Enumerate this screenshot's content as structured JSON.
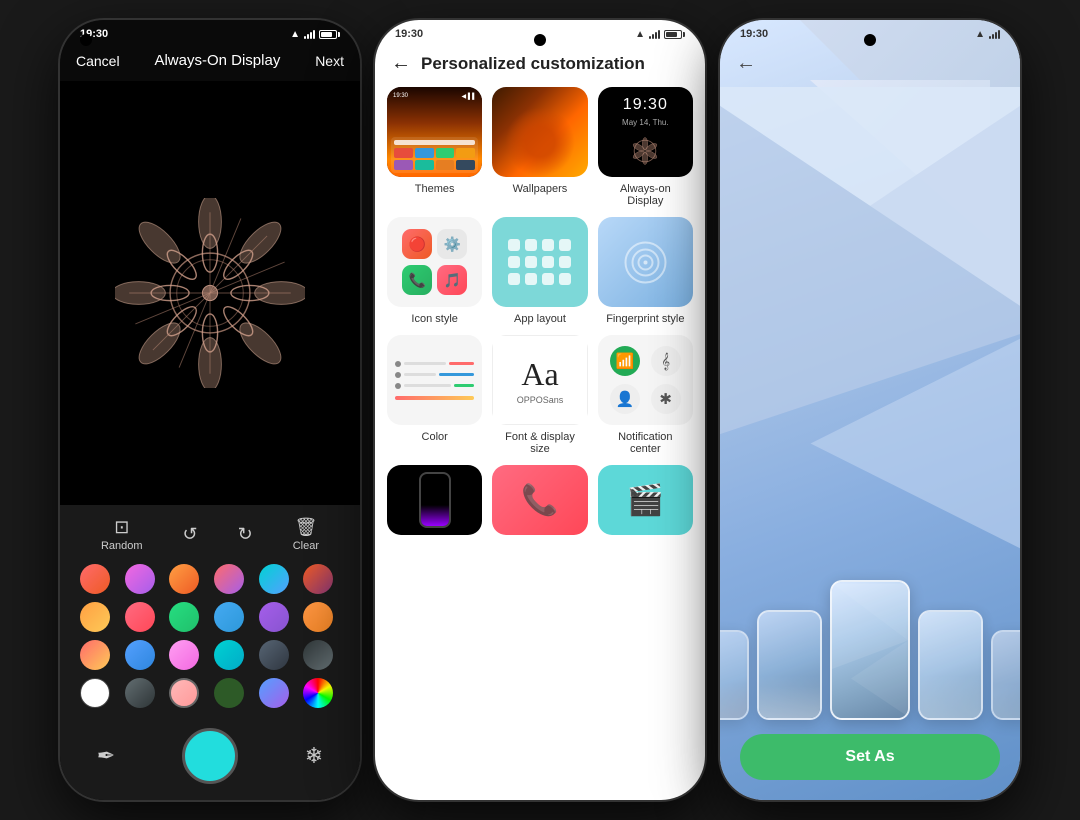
{
  "phone1": {
    "status_time": "19:30",
    "title": "Always-On Display",
    "cancel_label": "Cancel",
    "next_label": "Next",
    "toolbar": {
      "random_label": "Random",
      "clear_label": "Clear"
    },
    "colors": [
      {
        "id": "c1",
        "bg": "linear-gradient(135deg, #ff6b6b, #ee5a24)"
      },
      {
        "id": "c2",
        "bg": "linear-gradient(135deg, #f368e0, #a55eea)"
      },
      {
        "id": "c3",
        "bg": "linear-gradient(135deg, #ff9f43, #ee5a24)"
      },
      {
        "id": "c4",
        "bg": "linear-gradient(135deg, #ff6b6b, #a55eea)"
      },
      {
        "id": "c5",
        "bg": "linear-gradient(135deg, #00d2d3, #54a0ff)"
      },
      {
        "id": "c6",
        "bg": "linear-gradient(135deg, #ee5a24, #833471)"
      },
      {
        "id": "c7",
        "bg": "linear-gradient(135deg, #ff9f43, #feca57)"
      },
      {
        "id": "c8",
        "bg": "linear-gradient(135deg, #ff6b81, #ff4757)"
      },
      {
        "id": "c9",
        "bg": "linear-gradient(135deg, #26de81, #20bf6b)"
      },
      {
        "id": "c10",
        "bg": "linear-gradient(135deg, #45aaf2, #2d98da)"
      },
      {
        "id": "c11",
        "bg": "linear-gradient(135deg, #a55eea, #8854d0)"
      },
      {
        "id": "c12",
        "bg": "linear-gradient(135deg, #fd9644, #e67e22)"
      },
      {
        "id": "c13",
        "bg": "linear-gradient(135deg, #ff6b6b, #feca57)"
      },
      {
        "id": "c14",
        "bg": "linear-gradient(135deg, #54a0ff, #2e86de)"
      },
      {
        "id": "c15",
        "bg": "linear-gradient(135deg, #ff9ff3, #f368e0)"
      },
      {
        "id": "c16",
        "bg": "linear-gradient(135deg, #00d2d3, #01abc7)"
      },
      {
        "id": "c17",
        "bg": "linear-gradient(135deg, #576574, #2f3640)"
      },
      {
        "id": "c18",
        "bg": "linear-gradient(135deg, #2d3436, #636e72)"
      },
      {
        "id": "c19",
        "bg": "#ffffff"
      },
      {
        "id": "c20",
        "bg": "linear-gradient(135deg, #636e72, #2d3436)"
      },
      {
        "id": "c21",
        "bg": "linear-gradient(135deg, #ffb8b8, #ff9a9a)"
      },
      {
        "id": "c22",
        "bg": "#2d5a27"
      },
      {
        "id": "c23",
        "bg": "linear-gradient(135deg, #54a0ff, #a55eea)"
      },
      {
        "id": "c24",
        "bg": "conic-gradient(red, yellow, lime, cyan, blue, magenta, red)"
      }
    ]
  },
  "phone2": {
    "status_time": "19:30",
    "title": "Personalized customization",
    "back_label": "←",
    "items": [
      {
        "label": "Themes"
      },
      {
        "label": "Wallpapers"
      },
      {
        "label": "Always-on\nDisplay"
      },
      {
        "label": "Icon style"
      },
      {
        "label": "App layout"
      },
      {
        "label": "Fingerprint style"
      },
      {
        "label": "Color"
      },
      {
        "label": "Font & display\nsize"
      },
      {
        "label": "Notification\ncenter"
      }
    ]
  },
  "phone3": {
    "status_time": "19:30",
    "back_label": "←",
    "set_as_label": "Set As"
  }
}
